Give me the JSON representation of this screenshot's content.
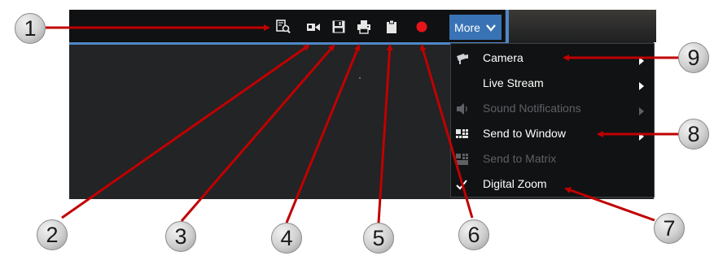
{
  "toolbar": {
    "more_label": "More",
    "icons": [
      "search-recordings-icon",
      "export-video-icon",
      "save-snapshot-icon",
      "print-icon",
      "clipboard-icon",
      "record-icon"
    ]
  },
  "menu": {
    "items": [
      {
        "label": "Camera",
        "enabled": true,
        "icon": "camera-icon",
        "submenu": true
      },
      {
        "label": "Live Stream",
        "enabled": true,
        "icon": "",
        "submenu": true
      },
      {
        "label": "Sound Notifications",
        "enabled": false,
        "icon": "speaker-icon",
        "submenu": true
      },
      {
        "label": "Send to Window",
        "enabled": true,
        "icon": "send-to-window-icon",
        "submenu": true
      },
      {
        "label": "Send to Matrix",
        "enabled": false,
        "icon": "matrix-icon",
        "submenu": false
      },
      {
        "label": "Digital Zoom",
        "enabled": true,
        "icon": "checkmark-icon",
        "submenu": false
      }
    ]
  },
  "callouts": [
    "1",
    "2",
    "3",
    "4",
    "5",
    "6",
    "7",
    "8",
    "9"
  ],
  "colors": {
    "arrow": "#c00000",
    "accent": "#3a73b5",
    "record": "#e8141b"
  }
}
